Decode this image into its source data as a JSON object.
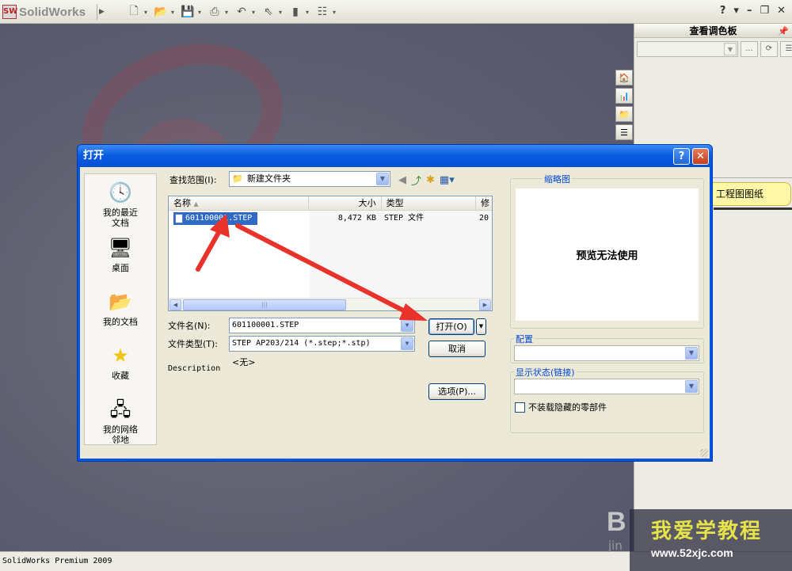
{
  "app": {
    "logo_text": "SolidWorks",
    "logo_mark": "SW",
    "status_text": "SolidWorks Premium 2009"
  },
  "task_pane": {
    "title": "查看调色板",
    "drawing_tab": "工程图图纸"
  },
  "dialog": {
    "title": "打开",
    "help_label": "?",
    "close_label": "✕",
    "look_in_label": "查找范围(I):",
    "look_in_value": "新建文件夹",
    "places": [
      {
        "label": "我的最近文档"
      },
      {
        "label": "桌面"
      },
      {
        "label": "我的文档"
      },
      {
        "label": "收藏"
      },
      {
        "label": "我的网络邻地"
      }
    ],
    "columns": {
      "name": "名称",
      "size": "大小",
      "type": "类型",
      "modified": "修"
    },
    "files": [
      {
        "name": "601100001.STEP",
        "size": "8,472 KB",
        "type": "STEP 文件",
        "modified": "20"
      }
    ],
    "filename_label": "文件名(N):",
    "filename_value": "601100001.STEP",
    "filetype_label": "文件类型(T):",
    "filetype_value": "STEP AP203/214 (*.step;*.stp)",
    "description_label": "Description",
    "description_value": "<无>",
    "open_button": "打开(O)",
    "cancel_button": "取消",
    "options_button": "选项(P)...",
    "thumbnail_caption": "缩略图",
    "preview_text": "预览无法使用",
    "config_caption": "配置",
    "display_state_caption": "显示状态(链接)",
    "hidden_parts_checkbox": "不装载隐藏的零部件"
  },
  "watermark": {
    "title": "我爱学教程",
    "url": "www.52xjc.com",
    "b": "B",
    "jin": "jin"
  },
  "colors": {
    "dialog_title": "#0a5ce0",
    "selection": "#316ac5",
    "annotation": "#e8322a",
    "drawing_tab": "#fff7a8",
    "watermark_title": "#e6e34a"
  }
}
